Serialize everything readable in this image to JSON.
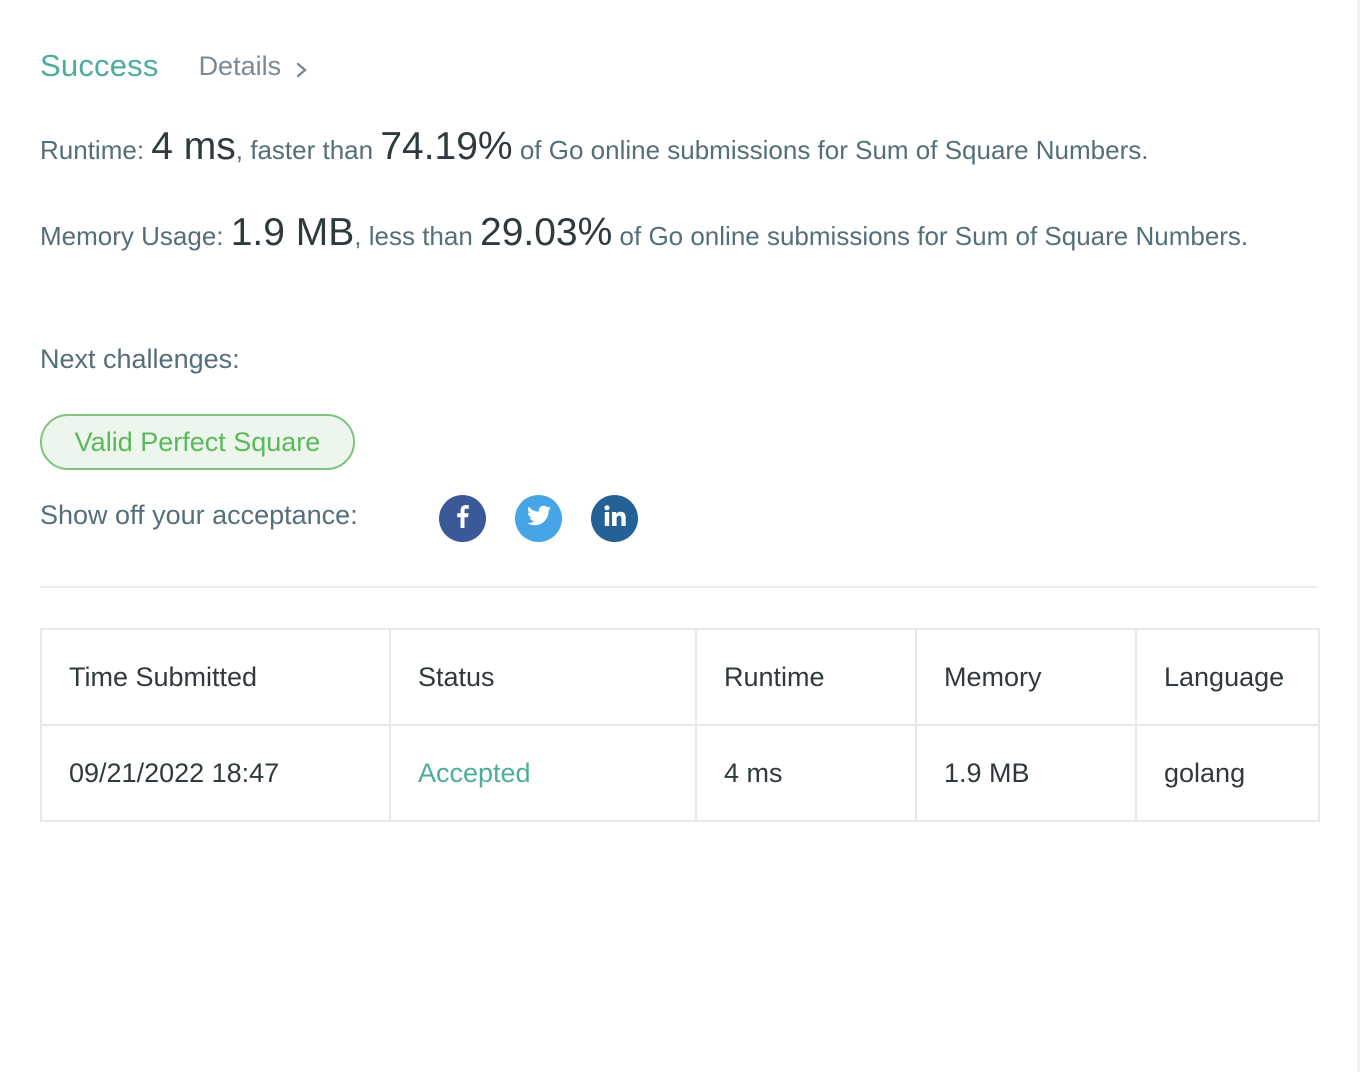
{
  "header": {
    "status": "Success",
    "details_label": "Details"
  },
  "runtime": {
    "label": "Runtime:",
    "value": "4 ms",
    "comparison": ", faster than ",
    "percent": "74.19%",
    "suffix": " of Go online submissions for Sum of Square Numbers."
  },
  "memory": {
    "label": "Memory Usage:",
    "value": "1.9 MB",
    "comparison": ", less than ",
    "percent": "29.03%",
    "suffix": " of Go online submissions for Sum of Square Numbers."
  },
  "next_challenges": {
    "label": "Next challenges:",
    "items": [
      "Valid Perfect Square"
    ]
  },
  "share": {
    "label": "Show off your acceptance:",
    "icons": [
      "facebook-icon",
      "twitter-icon",
      "linkedin-icon"
    ]
  },
  "table": {
    "headers": [
      "Time Submitted",
      "Status",
      "Runtime",
      "Memory",
      "Language"
    ],
    "rows": [
      [
        "09/21/2022 18:47",
        "Accepted",
        "4 ms",
        "1.9 MB",
        "golang"
      ]
    ]
  },
  "colors": {
    "success": "#4cae9a",
    "chip_border": "#7cc47f",
    "facebook": "#3b5998",
    "twitter": "#45a5e6",
    "linkedin": "#246197"
  }
}
